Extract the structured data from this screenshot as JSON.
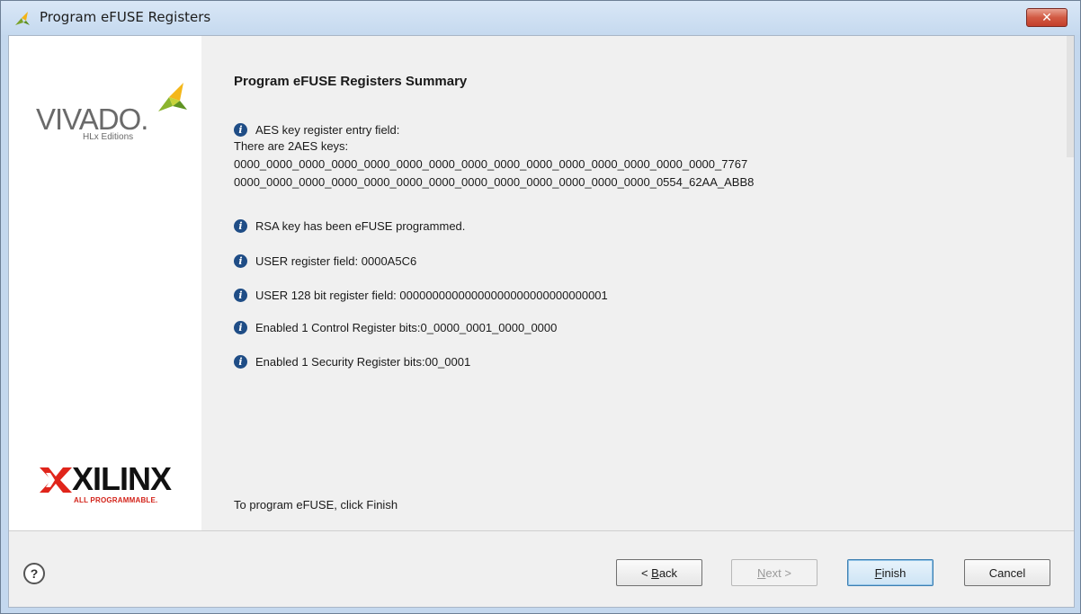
{
  "window": {
    "title": "Program eFUSE Registers",
    "close_glyph": "✕"
  },
  "sidebar": {
    "vivado_logo_text": "VIVADO.",
    "vivado_logo_subtext": "HLx Editions",
    "xilinx_logo_text": "XILINX",
    "xilinx_logo_tagline": "ALL PROGRAMMABLE."
  },
  "content": {
    "title": "Program eFUSE Registers Summary",
    "aes_heading": "AES key register entry field:",
    "aes_count_line": "There are 2AES keys:",
    "aes_keys": [
      "0000_0000_0000_0000_0000_0000_0000_0000_0000_0000_0000_0000_0000_0000_0000_7767",
      "0000_0000_0000_0000_0000_0000_0000_0000_0000_0000_0000_0000_0000_0554_62AA_ABB8"
    ],
    "messages": [
      "RSA key has been eFUSE programmed.",
      "USER register field: 0000A5C6",
      "USER 128 bit register field: 00000000000000000000000000000001",
      "Enabled 1 Control Register bits:0_0000_0001_0000_0000",
      "Enabled 1 Security Register bits:00_0001"
    ],
    "footer": "To program eFUSE, click Finish"
  },
  "buttons": {
    "help": "?",
    "back": {
      "prefix": "< ",
      "hotkey": "B",
      "rest": "ack"
    },
    "next": {
      "hotkey": "N",
      "rest": "ext >"
    },
    "finish": {
      "hotkey": "F",
      "rest": "inish"
    },
    "cancel": "Cancel"
  },
  "colors": {
    "info_icon": "#1f4d86",
    "title_bar": "#c5d9ef",
    "close_button": "#c33f2b",
    "primary_button_border": "#3c7fb1"
  },
  "icons": {
    "window_icon": "vivado-leaf-icon",
    "info": "info-icon",
    "help": "help-question-icon"
  }
}
